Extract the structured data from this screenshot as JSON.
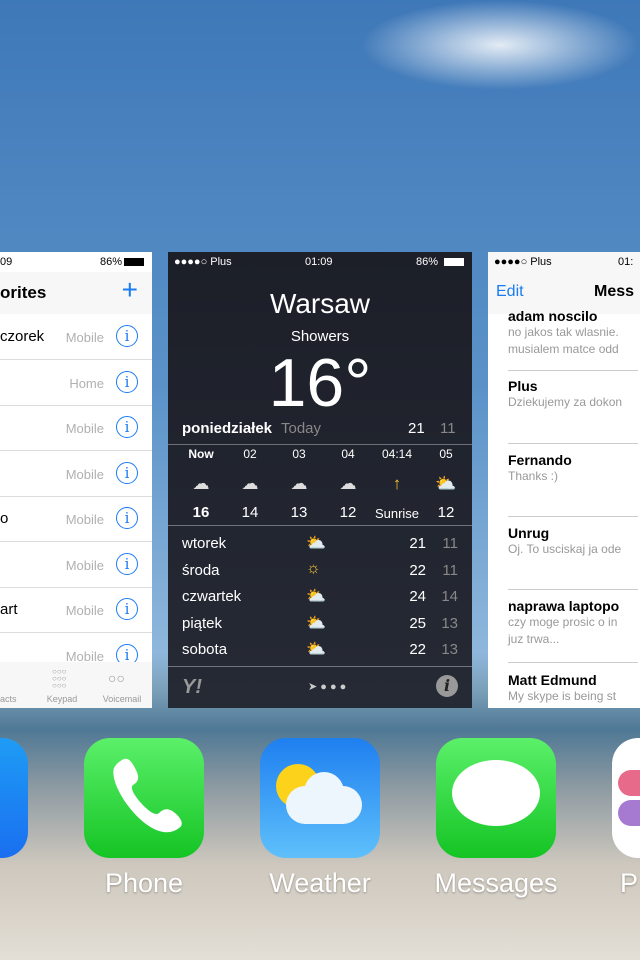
{
  "phone_card": {
    "status_time": "09",
    "battery": "86%",
    "title": "orites",
    "add": "+",
    "rows": [
      {
        "name": "czorek",
        "type": "Mobile"
      },
      {
        "name": "",
        "type": "Home"
      },
      {
        "name": "",
        "type": "Mobile"
      },
      {
        "name": "",
        "type": "Mobile"
      },
      {
        "name": "o",
        "type": "Mobile"
      },
      {
        "name": "",
        "type": "Mobile"
      },
      {
        "name": "art",
        "type": "Mobile"
      },
      {
        "name": "",
        "type": "Mobile"
      }
    ],
    "tabs": [
      "acts",
      "Keypad",
      "Voicemail"
    ]
  },
  "weather_card": {
    "carrier": "●●●●○ Plus",
    "time": "01:09",
    "battery": "86%",
    "city": "Warsaw",
    "condition": "Showers",
    "temp": "16°",
    "today": {
      "day": "poniedziałek",
      "label": "Today",
      "hi": "21",
      "lo": "11"
    },
    "hours": [
      {
        "h": "Now",
        "icon": "rain-cloud",
        "t": "16"
      },
      {
        "h": "02",
        "icon": "partly-cloudy-night",
        "t": "14"
      },
      {
        "h": "03",
        "icon": "partly-cloudy-night",
        "t": "13"
      },
      {
        "h": "04",
        "icon": "partly-cloudy-night",
        "t": "12"
      },
      {
        "h": "04:14",
        "icon": "sunrise",
        "t": "Sunrise"
      },
      {
        "h": "05",
        "icon": "partly-sunny",
        "t": "12"
      }
    ],
    "days": [
      {
        "d": "wtorek",
        "icon": "partly-sunny",
        "hi": "21",
        "lo": "11"
      },
      {
        "d": "środa",
        "icon": "sunny",
        "hi": "22",
        "lo": "11"
      },
      {
        "d": "czwartek",
        "icon": "partly-sunny",
        "hi": "24",
        "lo": "14"
      },
      {
        "d": "piątek",
        "icon": "partly-sunny",
        "hi": "25",
        "lo": "13"
      },
      {
        "d": "sobota",
        "icon": "partly-sunny",
        "hi": "22",
        "lo": "13"
      }
    ],
    "yahoo": "Y!",
    "info": "i"
  },
  "messages_card": {
    "carrier": "●●●●○ Plus",
    "time": "01:",
    "edit": "Edit",
    "title": "Mess",
    "threads": [
      {
        "name": "adam noscilo",
        "preview": [
          "no jakos tak wlasnie.",
          "musialem matce odd"
        ]
      },
      {
        "name": "Plus",
        "preview": [
          "Dziekujemy za dokon"
        ]
      },
      {
        "name": "Fernando",
        "preview": [
          "Thanks :)"
        ]
      },
      {
        "name": "Unrug",
        "preview": [
          "Oj. To usciskaj ja ode"
        ]
      },
      {
        "name": "naprawa laptopo",
        "preview": [
          "czy moge prosic o in",
          "juz trwa..."
        ]
      },
      {
        "name": "Matt Edmund",
        "preview": [
          "My skype is being st"
        ]
      }
    ]
  },
  "dock": {
    "labels": [
      "Phone",
      "Weather",
      "Messages",
      "P"
    ]
  },
  "colors": {
    "ios_blue": "#1a7cf5",
    "phone_green": "#2bd143",
    "weather_blue": "#2a8af0"
  }
}
